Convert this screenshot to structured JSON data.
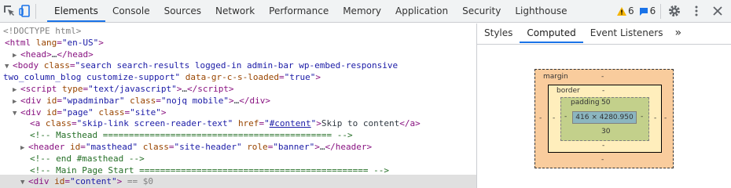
{
  "toolbar": {
    "tabs": [
      "Elements",
      "Console",
      "Sources",
      "Network",
      "Performance",
      "Memory",
      "Application",
      "Security",
      "Lighthouse"
    ],
    "warnings_count": "6",
    "messages_count": "6"
  },
  "dom": {
    "lines": [
      {
        "indent": 0,
        "tri": "",
        "html": "<span class='g'>&lt;!DOCTYPE html&gt;</span>"
      },
      {
        "indent": 0,
        "tri": "",
        "html": "<span class='t'>&lt;html</span> <span class='a'>lang</span><span class='t'>=</span><span class='v'>\"en-US\"</span><span class='t'>&gt;</span>"
      },
      {
        "indent": 1,
        "tri": "▶",
        "html": "<span class='t'>&lt;head&gt;</span>…<span class='t'>&lt;/head&gt;</span>"
      },
      {
        "indent": 1,
        "tri": "▼",
        "html": "<span class='t'>&lt;body</span> <span class='a'>class</span><span class='t'>=</span><span class='v'>\"search search-results logged-in admin-bar wp-embed-responsive</span>"
      },
      {
        "indent": 0,
        "tri": "",
        "html": "<span class='v'>two_column_blog customize-support\"</span> <span class='a'>data-gr-c-s-loaded</span><span class='t'>=</span><span class='v'>\"true\"</span><span class='t'>&gt;</span>"
      },
      {
        "indent": 2,
        "tri": "▶",
        "html": "<span class='t'>&lt;script</span> <span class='a'>type</span><span class='t'>=</span><span class='v'>\"text/javascript\"</span><span class='t'>&gt;</span>…<span class='t'>&lt;/script&gt;</span>"
      },
      {
        "indent": 2,
        "tri": "▶",
        "html": "<span class='t'>&lt;div</span> <span class='a'>id</span><span class='t'>=</span><span class='v'>\"wpadminbar\"</span> <span class='a'>class</span><span class='t'>=</span><span class='v'>\"nojq mobile\"</span><span class='t'>&gt;</span>…<span class='t'>&lt;/div&gt;</span>"
      },
      {
        "indent": 2,
        "tri": "▼",
        "html": "<span class='t'>&lt;div</span> <span class='a'>id</span><span class='t'>=</span><span class='v'>\"page\"</span> <span class='a'>class</span><span class='t'>=</span><span class='v'>\"site\"</span><span class='t'>&gt;</span>"
      },
      {
        "indent": 3,
        "tri": "",
        "html": "<span class='t'>&lt;a</span> <span class='a'>class</span><span class='t'>=</span><span class='v'>\"skip-link screen-reader-text\"</span> <span class='a'>href</span><span class='t'>=</span><span class='v'>\"<span class='lnk'>#content</span>\"</span><span class='t'>&gt;</span>Skip to content<span class='t'>&lt;/a&gt;</span>"
      },
      {
        "indent": 3,
        "tri": "",
        "html": "<span class='c'>&lt;!-- Masthead ============================================ --&gt;</span>"
      },
      {
        "indent": 3,
        "tri": "▶",
        "html": "<span class='t'>&lt;header</span> <span class='a'>id</span><span class='t'>=</span><span class='v'>\"masthead\"</span> <span class='a'>class</span><span class='t'>=</span><span class='v'>\"site-header\"</span> <span class='a'>role</span><span class='t'>=</span><span class='v'>\"banner\"</span><span class='t'>&gt;</span>…<span class='t'>&lt;/header&gt;</span>"
      },
      {
        "indent": 3,
        "tri": "",
        "html": "<span class='c'>&lt;!-- end #masthead --&gt;</span>"
      },
      {
        "indent": 3,
        "tri": "",
        "html": "<span class='c'>&lt;!-- Main Page Start ============================================ --&gt;</span>"
      },
      {
        "indent": 2,
        "tri": "▼",
        "html": "<span class='t'>&lt;div</span> <span class='a'>id</span><span class='t'>=</span><span class='v'>\"content\"</span><span class='t'>&gt;</span> <span class='g'>== $0</span>",
        "selected": true
      }
    ]
  },
  "styles_panel": {
    "tabs": [
      "Styles",
      "Computed",
      "Event Listeners"
    ],
    "more": "»"
  },
  "box_model": {
    "margin_label": "margin",
    "margin_top": "-",
    "margin_bottom": "-",
    "margin_left": "-",
    "margin_right": "-",
    "border_label": "border",
    "border_top": "-",
    "border_bottom": "-",
    "border_left": "-",
    "border_right": "-",
    "padding_label": "padding",
    "padding_top": "50",
    "padding_bottom": "30",
    "padding_left": "-",
    "padding_right": "-",
    "content_size": "416 × 4280.950"
  }
}
